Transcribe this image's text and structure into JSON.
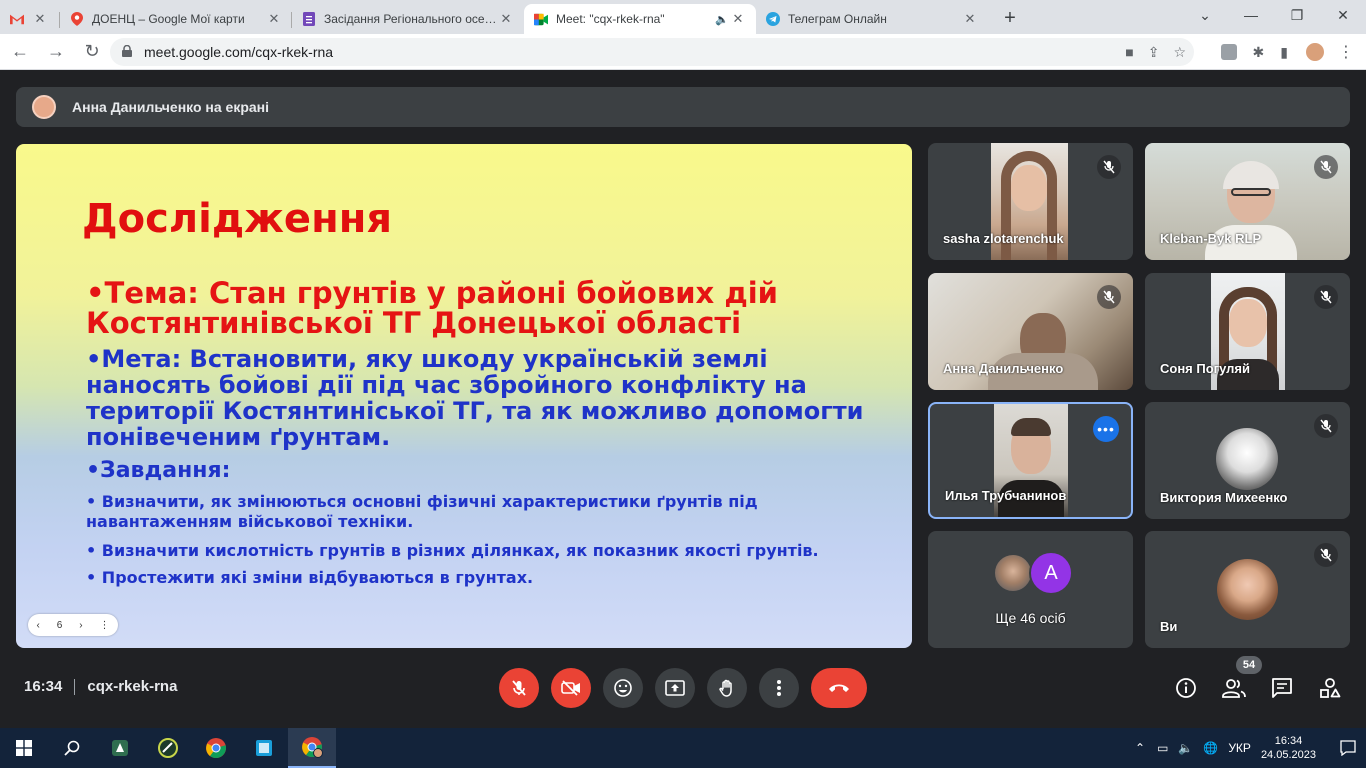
{
  "browser": {
    "tabs": [
      {
        "title": "",
        "icon": "gmail-icon",
        "active": false
      },
      {
        "title": "ДОЕНЦ – Google Мої карти",
        "icon": "maps-icon",
        "active": false
      },
      {
        "title": "Засідання Регіонального осеред",
        "icon": "forms-icon",
        "active": false
      },
      {
        "title": "Meet: \"cqx-rkek-rna\"",
        "icon": "meet-icon",
        "active": true
      },
      {
        "title": "Телеграм Онлайн",
        "icon": "telegram-icon",
        "active": false
      }
    ],
    "url": "meet.google.com/cqx-rkek-rna"
  },
  "meet": {
    "presenting_label": "Анна Данильченко на екрані",
    "slide": {
      "title": "Дослідження",
      "topic": "•Тема: Стан грунтів у районі бойових дій Костянтинівської ТГ Донецької області",
      "goal": "•Мета: Встановити, яку шкоду українській землі наносять бойові дії під час збройного конфлікту на території Костянтиніської ТГ, та як можливо допомогти понівеченим ґрунтам.",
      "tasks_heading": "•Завдання:",
      "task1": "• Визначити, як змінюються основні фізичні характеристики ґрунтів під навантаженням військової техніки.",
      "task2": "• Визначити кислотність грунтів в різних ділянках, як показник якості грунтів.",
      "task3": "• Простежити які зміни відбуваються в грунтах.",
      "page": "6"
    },
    "participants": [
      {
        "name": "sasha zlotarenchuk",
        "muted": true
      },
      {
        "name": "Kleban-Byk RLP",
        "muted": true
      },
      {
        "name": "Анна Данильченко",
        "muted": true
      },
      {
        "name": "Соня Погуляй",
        "muted": true
      },
      {
        "name": "Илья Трубчанинов",
        "muted": false
      },
      {
        "name": "Виктория Михеенко",
        "muted": true
      },
      {
        "name": "Ще 46 осіб",
        "avatar_letter": "A"
      },
      {
        "name": "Ви",
        "muted": true
      }
    ],
    "time": "16:34",
    "meeting_code": "cqx-rkek-rna",
    "participant_count": "54"
  },
  "taskbar": {
    "language": "УКР",
    "time": "16:34",
    "date": "24.05.2023"
  },
  "colors": {
    "meet_bg": "#202124",
    "tile_bg": "#3c4043",
    "end_call": "#ea4335",
    "slide_title": "#e10f0f",
    "slide_text": "#1f33c8"
  }
}
